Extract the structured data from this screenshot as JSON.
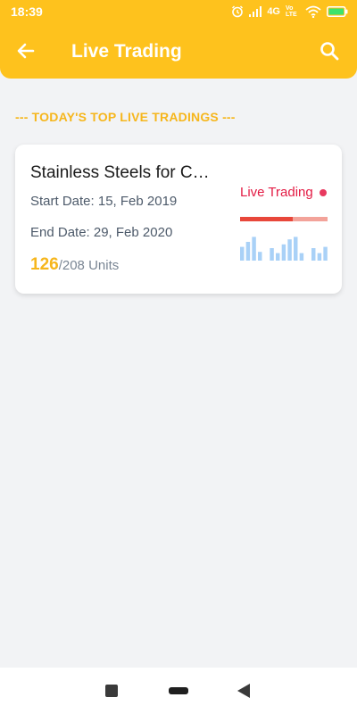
{
  "status_bar": {
    "time": "18:39",
    "network": "4G",
    "volte": "Vo LTE",
    "icons": [
      "alarm-icon",
      "signal-icon",
      "wifi-icon",
      "battery-icon"
    ]
  },
  "app_bar": {
    "title": "Live Trading",
    "background": "#fec21d",
    "back_icon": "arrow-left-icon",
    "search_icon": "search-icon"
  },
  "section": {
    "heading": "--- TODAY'S TOP LIVE TRADINGS ---"
  },
  "trading_card": {
    "title": "Stainless Steels for C…",
    "start_date": "Start Date: 15, Feb 2019",
    "end_date": "End Date: 29, Feb 2020",
    "units_current": "126",
    "units_total": "/208 Units",
    "status_label": "Live Trading",
    "status_color": "#e31b44",
    "progress_fraction": 0.6,
    "mini_chart_values": [
      0.55,
      0.75,
      0.95,
      0.35,
      0,
      0.5,
      0.3,
      0.65,
      0.85,
      0.95,
      0.3,
      0,
      0.5,
      0.3,
      0.55
    ],
    "mini_chart_color": "#a9d1f7"
  },
  "nav_bar": {
    "icons": [
      "recents-square-icon",
      "home-pill-icon",
      "back-triangle-icon"
    ]
  }
}
